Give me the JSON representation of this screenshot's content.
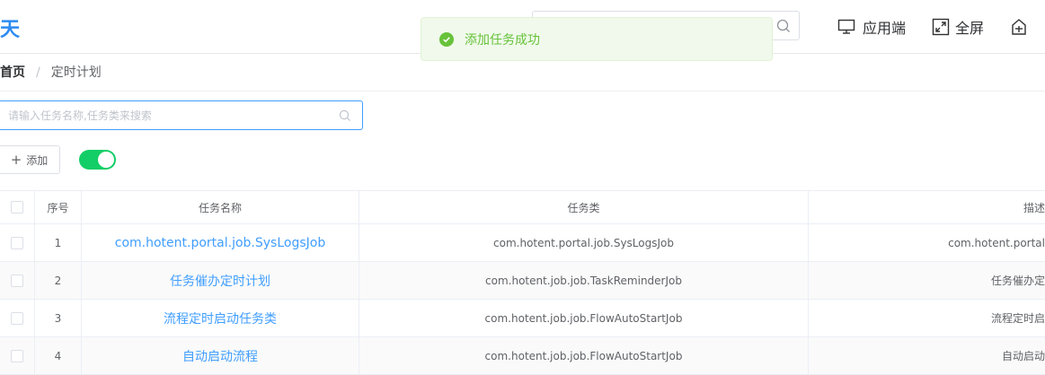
{
  "header": {
    "logo_text": "天",
    "search_placeholder": "",
    "actions": [
      {
        "label": "应用端",
        "icon": "monitor-icon"
      },
      {
        "label": "全屏",
        "icon": "fullscreen-icon"
      },
      {
        "label": "",
        "icon": "tag-icon"
      }
    ]
  },
  "toast": {
    "message": "添加任务成功",
    "type": "success"
  },
  "breadcrumb": {
    "home": "首页",
    "separator": "/",
    "current": "定时计划"
  },
  "toolbar": {
    "search_placeholder": "请输入任务名称,任务类来搜索",
    "add_label": "添加",
    "switch_on": true
  },
  "table": {
    "columns": {
      "no": "序号",
      "name": "任务名称",
      "class": "任务类",
      "desc": "描述"
    },
    "rows": [
      {
        "no": "1",
        "name": "com.hotent.portal.job.SysLogsJob",
        "class": "com.hotent.portal.job.SysLogsJob",
        "desc": "com.hotent.portal"
      },
      {
        "no": "2",
        "name": "任务催办定时计划",
        "class": "com.hotent.job.job.TaskReminderJob",
        "desc": "任务催办定"
      },
      {
        "no": "3",
        "name": "流程定时启动任务类",
        "class": "com.hotent.job.job.FlowAutoStartJob",
        "desc": "流程定时启"
      },
      {
        "no": "4",
        "name": "自动启动流程",
        "class": "com.hotent.job.job.FlowAutoStartJob",
        "desc": "自动启动"
      }
    ]
  },
  "colors": {
    "primary": "#409eff",
    "success": "#67c23a",
    "switch_on": "#13ce66"
  }
}
